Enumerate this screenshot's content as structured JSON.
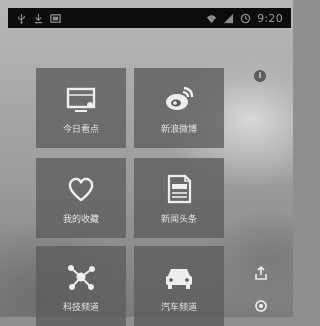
{
  "status_bar": {
    "time": "9:20",
    "left_icons": [
      "usb-icon",
      "download-icon",
      "screenshot-icon"
    ],
    "right_icons": [
      "wifi-icon",
      "signal-icon",
      "sync-icon"
    ]
  },
  "info_badge": {
    "glyph": "i"
  },
  "tiles": [
    {
      "label": "今日看点",
      "icon": "tv-icon"
    },
    {
      "label": "新浪微博",
      "icon": "weibo-icon"
    },
    {
      "label": "我的收藏",
      "icon": "heart-icon"
    },
    {
      "label": "新闻头条",
      "icon": "newspaper-icon"
    },
    {
      "label": "科技频道",
      "icon": "network-icon"
    },
    {
      "label": "汽车频道",
      "icon": "car-icon"
    }
  ],
  "side_icons": [
    "share-icon",
    "settings-icon"
  ],
  "colors": {
    "tile_bg": "#5c5c5c",
    "status_bar_bg": "#0c0c0c",
    "text_light": "#e6e6e6"
  }
}
